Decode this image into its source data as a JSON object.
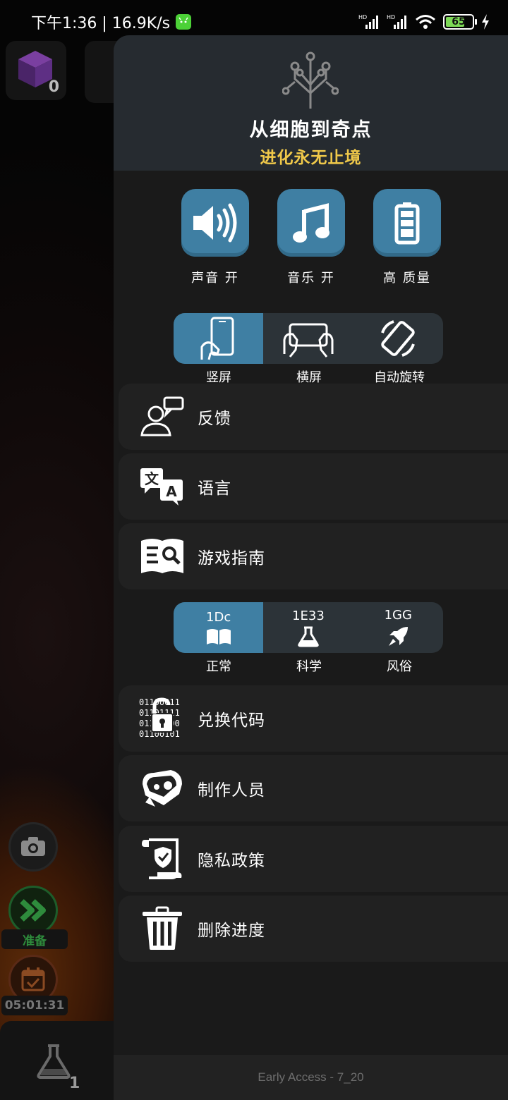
{
  "status_bar": {
    "time_speed": "下午1:36 | 16.9K/s",
    "battery": "65"
  },
  "background": {
    "cube_count": "0",
    "ready_label": "准备",
    "timer": "05:01:31",
    "flask_count": "1"
  },
  "panel": {
    "title": "从细胞到奇点",
    "subtitle": "进化永无止境",
    "settings": [
      {
        "label": "声音 开",
        "icon": "speaker-icon"
      },
      {
        "label": "音乐 开",
        "icon": "music-note-icon"
      },
      {
        "label": "高 质量",
        "icon": "battery-quality-icon"
      }
    ],
    "orientation": {
      "options": [
        "竖屏",
        "横屏",
        "自动旋转"
      ],
      "selected": "竖屏"
    },
    "menu_top": [
      {
        "label": "反馈",
        "icon": "feedback-icon"
      },
      {
        "label": "语言",
        "icon": "language-icon"
      },
      {
        "label": "游戏指南",
        "icon": "guide-book-icon"
      }
    ],
    "number_format": {
      "options": [
        {
          "label": "正常",
          "example": "1Dc",
          "icon": "book-icon"
        },
        {
          "label": "科学",
          "example": "1E33",
          "icon": "flask-icon"
        },
        {
          "label": "风俗",
          "example": "1GG",
          "icon": "rocket-icon"
        }
      ],
      "selected": "正常"
    },
    "menu_bottom": [
      {
        "label": "兑换代码",
        "icon": "binary-lock-icon"
      },
      {
        "label": "制作人员",
        "icon": "credits-icon"
      },
      {
        "label": "隐私政策",
        "icon": "privacy-scroll-icon"
      },
      {
        "label": "删除进度",
        "icon": "trash-icon"
      }
    ],
    "version": "Early Access - 7_20"
  }
}
